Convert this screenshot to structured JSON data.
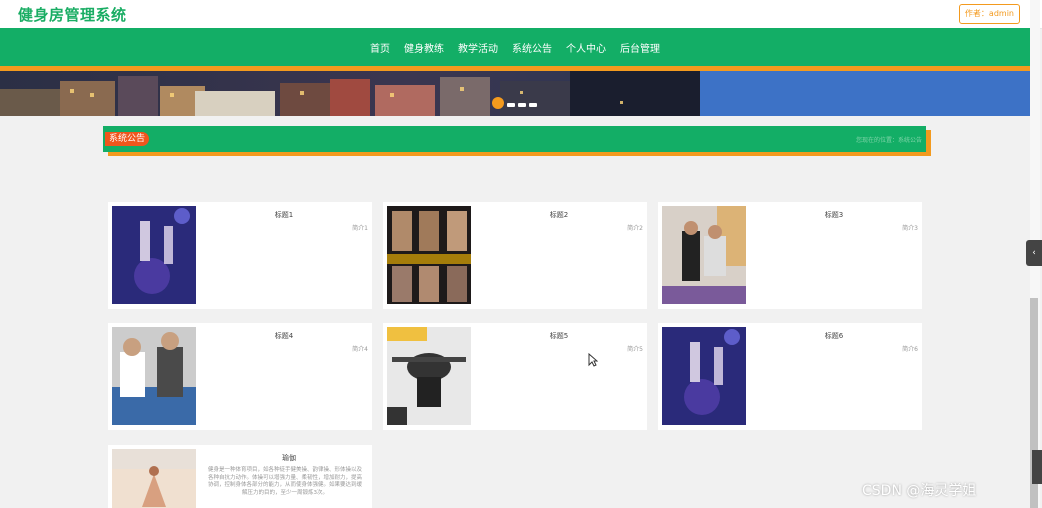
{
  "header": {
    "site_title": "健身房管理系统",
    "author_label": "作者：admin"
  },
  "nav": {
    "items": [
      "首页",
      "健身教练",
      "教学活动",
      "系统公告",
      "个人中心",
      "后台管理"
    ]
  },
  "section": {
    "tag": "系统公告",
    "breadcrumb": "您现在的位置：系统公告"
  },
  "cards": [
    {
      "title": "标题1",
      "intro": "简介1"
    },
    {
      "title": "标题2",
      "intro": "简介2"
    },
    {
      "title": "标题3",
      "intro": "简介3"
    },
    {
      "title": "标题4",
      "intro": "简介4"
    },
    {
      "title": "标题5",
      "intro": "简介5"
    },
    {
      "title": "标题6",
      "intro": "简介6"
    }
  ],
  "yoga_card": {
    "title": "瑜伽",
    "text": "健身是一种体育项目，如各种徒手健美操、韵律操、形体操以及各种自抗力动作。体操可以增强力量、柔韧性，增加耐力，提高协调，控制身体各部分的能力，从而使身体强健。如果要达到缓解压力的目的，至少一周锻炼3次。"
  },
  "side_tab_icon": "chevron-left-icon",
  "watermark": "CSDN @海灵学姐",
  "colors": {
    "primary_green": "#13ae66",
    "accent_orange": "#f39a1e",
    "tag_red": "#f0561d"
  }
}
